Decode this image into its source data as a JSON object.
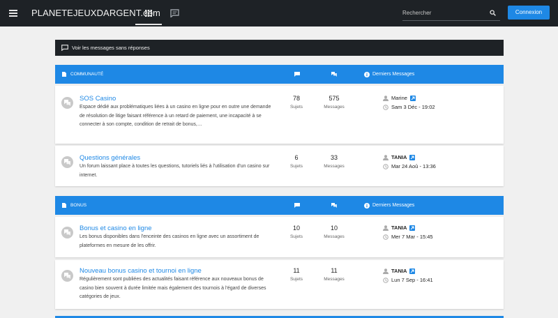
{
  "topbar": {
    "brand": "PLANETEJEUXDARGENT.com",
    "search_placeholder": "Rechercher",
    "login_label": "Connexion"
  },
  "unanswered": {
    "label": "Voir les messages sans réponses"
  },
  "categories": [
    {
      "name": "COMMUNAUTÉ",
      "last_messages_label": "Derniers Messages",
      "forums": [
        {
          "title": "SOS Casino",
          "description": "Espace dédié aux problématiques liées à un casino en ligne pour en outre une demande de résolution de litige faisant référence à un retard de paiement, une incapacité à se connecter à son compte, condition de retrait de bonus,…",
          "topics": "78",
          "topics_label": "Sujets",
          "posts": "575",
          "posts_label": "Messages",
          "last_user": "Marine",
          "last_date": "Sam 3 Déc - 19:02"
        },
        {
          "title": "Questions générales",
          "description": "Un forum laissant place à toutes les questions, tutoriels liés à l'utilisation d'un casino sur internet.",
          "topics": "6",
          "topics_label": "Sujets",
          "posts": "33",
          "posts_label": "Messages",
          "last_user": "TANIA",
          "last_date": "Mar 24 Aoû - 13:36"
        }
      ]
    },
    {
      "name": "BONUS",
      "last_messages_label": "Derniers Messages",
      "forums": [
        {
          "title": "Bonus et casino en ligne",
          "description": "Les bonus disponibles dans l'enceinte des casinos en ligne avec un assortiment de plateformes en mesure de les offrir.",
          "topics": "10",
          "topics_label": "Sujets",
          "posts": "10",
          "posts_label": "Messages",
          "last_user": "TANIA",
          "last_date": "Mer 7 Mar - 15:45"
        },
        {
          "title": "Nouveau bonus casino et tournoi en ligne",
          "description": "Régulièrement sont publiées des actualités faisant référence aux nouveaux bonus de casino bien souvent à durée limitée mais également des tournois à l'égard de diverses catégories de jeux.",
          "topics": "11",
          "topics_label": "Sujets",
          "posts": "11",
          "posts_label": "Messages",
          "last_user": "TANIA",
          "last_date": "Lun 7 Sep - 16:41"
        }
      ]
    }
  ]
}
